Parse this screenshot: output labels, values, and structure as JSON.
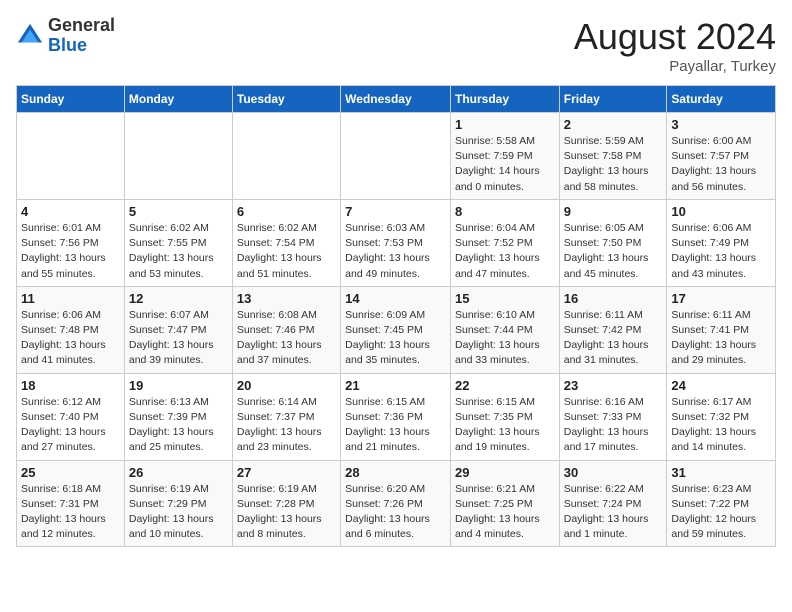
{
  "header": {
    "logo_general": "General",
    "logo_blue": "Blue",
    "month_year": "August 2024",
    "location": "Payallar, Turkey"
  },
  "days_of_week": [
    "Sunday",
    "Monday",
    "Tuesday",
    "Wednesday",
    "Thursday",
    "Friday",
    "Saturday"
  ],
  "weeks": [
    [
      {
        "day": "",
        "info": ""
      },
      {
        "day": "",
        "info": ""
      },
      {
        "day": "",
        "info": ""
      },
      {
        "day": "",
        "info": ""
      },
      {
        "day": "1",
        "info": "Sunrise: 5:58 AM\nSunset: 7:59 PM\nDaylight: 14 hours\nand 0 minutes."
      },
      {
        "day": "2",
        "info": "Sunrise: 5:59 AM\nSunset: 7:58 PM\nDaylight: 13 hours\nand 58 minutes."
      },
      {
        "day": "3",
        "info": "Sunrise: 6:00 AM\nSunset: 7:57 PM\nDaylight: 13 hours\nand 56 minutes."
      }
    ],
    [
      {
        "day": "4",
        "info": "Sunrise: 6:01 AM\nSunset: 7:56 PM\nDaylight: 13 hours\nand 55 minutes."
      },
      {
        "day": "5",
        "info": "Sunrise: 6:02 AM\nSunset: 7:55 PM\nDaylight: 13 hours\nand 53 minutes."
      },
      {
        "day": "6",
        "info": "Sunrise: 6:02 AM\nSunset: 7:54 PM\nDaylight: 13 hours\nand 51 minutes."
      },
      {
        "day": "7",
        "info": "Sunrise: 6:03 AM\nSunset: 7:53 PM\nDaylight: 13 hours\nand 49 minutes."
      },
      {
        "day": "8",
        "info": "Sunrise: 6:04 AM\nSunset: 7:52 PM\nDaylight: 13 hours\nand 47 minutes."
      },
      {
        "day": "9",
        "info": "Sunrise: 6:05 AM\nSunset: 7:50 PM\nDaylight: 13 hours\nand 45 minutes."
      },
      {
        "day": "10",
        "info": "Sunrise: 6:06 AM\nSunset: 7:49 PM\nDaylight: 13 hours\nand 43 minutes."
      }
    ],
    [
      {
        "day": "11",
        "info": "Sunrise: 6:06 AM\nSunset: 7:48 PM\nDaylight: 13 hours\nand 41 minutes."
      },
      {
        "day": "12",
        "info": "Sunrise: 6:07 AM\nSunset: 7:47 PM\nDaylight: 13 hours\nand 39 minutes."
      },
      {
        "day": "13",
        "info": "Sunrise: 6:08 AM\nSunset: 7:46 PM\nDaylight: 13 hours\nand 37 minutes."
      },
      {
        "day": "14",
        "info": "Sunrise: 6:09 AM\nSunset: 7:45 PM\nDaylight: 13 hours\nand 35 minutes."
      },
      {
        "day": "15",
        "info": "Sunrise: 6:10 AM\nSunset: 7:44 PM\nDaylight: 13 hours\nand 33 minutes."
      },
      {
        "day": "16",
        "info": "Sunrise: 6:11 AM\nSunset: 7:42 PM\nDaylight: 13 hours\nand 31 minutes."
      },
      {
        "day": "17",
        "info": "Sunrise: 6:11 AM\nSunset: 7:41 PM\nDaylight: 13 hours\nand 29 minutes."
      }
    ],
    [
      {
        "day": "18",
        "info": "Sunrise: 6:12 AM\nSunset: 7:40 PM\nDaylight: 13 hours\nand 27 minutes."
      },
      {
        "day": "19",
        "info": "Sunrise: 6:13 AM\nSunset: 7:39 PM\nDaylight: 13 hours\nand 25 minutes."
      },
      {
        "day": "20",
        "info": "Sunrise: 6:14 AM\nSunset: 7:37 PM\nDaylight: 13 hours\nand 23 minutes."
      },
      {
        "day": "21",
        "info": "Sunrise: 6:15 AM\nSunset: 7:36 PM\nDaylight: 13 hours\nand 21 minutes."
      },
      {
        "day": "22",
        "info": "Sunrise: 6:15 AM\nSunset: 7:35 PM\nDaylight: 13 hours\nand 19 minutes."
      },
      {
        "day": "23",
        "info": "Sunrise: 6:16 AM\nSunset: 7:33 PM\nDaylight: 13 hours\nand 17 minutes."
      },
      {
        "day": "24",
        "info": "Sunrise: 6:17 AM\nSunset: 7:32 PM\nDaylight: 13 hours\nand 14 minutes."
      }
    ],
    [
      {
        "day": "25",
        "info": "Sunrise: 6:18 AM\nSunset: 7:31 PM\nDaylight: 13 hours\nand 12 minutes."
      },
      {
        "day": "26",
        "info": "Sunrise: 6:19 AM\nSunset: 7:29 PM\nDaylight: 13 hours\nand 10 minutes."
      },
      {
        "day": "27",
        "info": "Sunrise: 6:19 AM\nSunset: 7:28 PM\nDaylight: 13 hours\nand 8 minutes."
      },
      {
        "day": "28",
        "info": "Sunrise: 6:20 AM\nSunset: 7:26 PM\nDaylight: 13 hours\nand 6 minutes."
      },
      {
        "day": "29",
        "info": "Sunrise: 6:21 AM\nSunset: 7:25 PM\nDaylight: 13 hours\nand 4 minutes."
      },
      {
        "day": "30",
        "info": "Sunrise: 6:22 AM\nSunset: 7:24 PM\nDaylight: 13 hours\nand 1 minute."
      },
      {
        "day": "31",
        "info": "Sunrise: 6:23 AM\nSunset: 7:22 PM\nDaylight: 12 hours\nand 59 minutes."
      }
    ]
  ]
}
